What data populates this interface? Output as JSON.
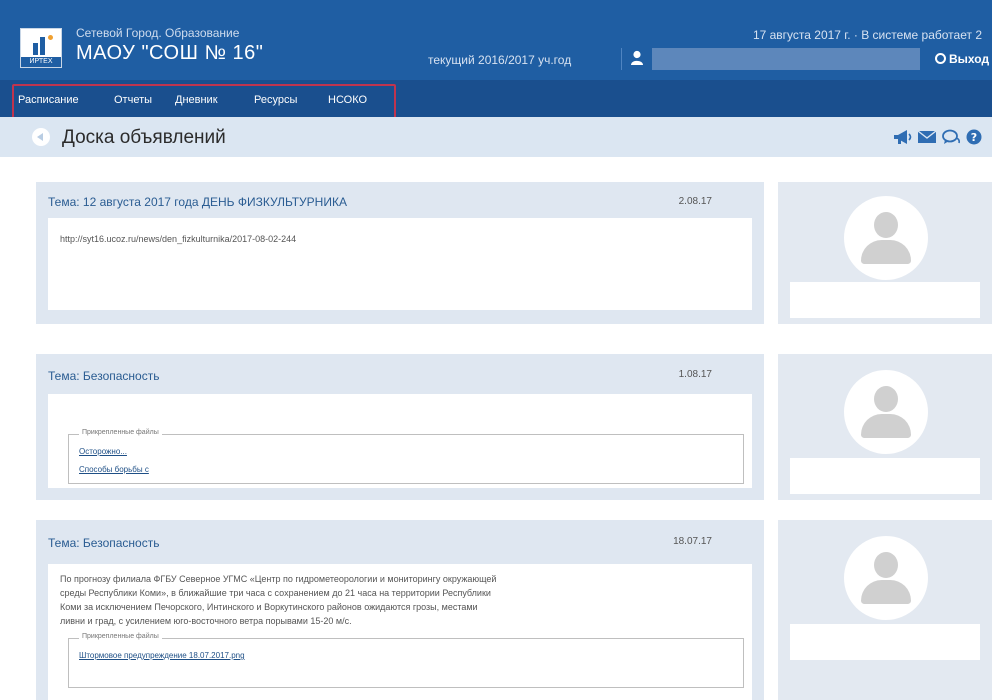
{
  "header": {
    "app_name": "Сетевой Город. Образование",
    "school_name": "МАОУ \"СОШ № 16\"",
    "logo_caption": "ИРТЕХ",
    "date_info": "17 августа 2017 г. · В системе работает 2",
    "school_year": "текущий 2016/2017 уч.год",
    "exit_label": "Выход"
  },
  "nav": {
    "items": [
      "Расписание",
      "Отчеты",
      "Дневник",
      "Ресурсы",
      "НСОКО"
    ]
  },
  "page": {
    "title": "Доска объявлений"
  },
  "posts": [
    {
      "topic": "Тема: 12 августа 2017 года ДЕНЬ ФИЗКУЛЬТУРНИКА",
      "date": "2.08.17",
      "text": "http://syt16.ucoz.ru/news/den_fizkulturnika/2017-08-02-244"
    },
    {
      "topic": "Тема: Безопасность",
      "date": "1.08.17",
      "attachments_label": "Прикрепленные файлы",
      "files": [
        "Осторожно...",
        "Способы борьбы с"
      ]
    },
    {
      "topic": "Тема: Безопасность",
      "date": "18.07.17",
      "text_lines": [
        "По прогнозу филиала ФГБУ Северное УГМС «Центр по гидрометеорологии и мониторингу окружающей",
        "среды Республики Коми», в ближайшие три часа с сохранением до 21 часа на территории Республики",
        "Коми за исключением Печорского, Интинского и Воркутинского районов ожидаются грозы, местами",
        "ливни и град, с усилением юго-восточного ветра порывами 15-20 м/с."
      ],
      "attachments_label": "Прикрепленные файлы",
      "files": [
        "Штормовое предупреждение 18.07.2017.png"
      ]
    }
  ],
  "colors": {
    "header_bg": "#1f5ea3",
    "nav_bg": "#1a4f8e",
    "titlebar_bg": "#dbe6f2",
    "card_bg": "#dfe7f1",
    "topic_text": "#2a5c92",
    "nav_highlight": "#c0344e"
  },
  "icons": [
    "megaphone-icon",
    "envelope-icon",
    "chat-icon",
    "help-icon",
    "user-icon",
    "power-icon",
    "back-icon"
  ]
}
